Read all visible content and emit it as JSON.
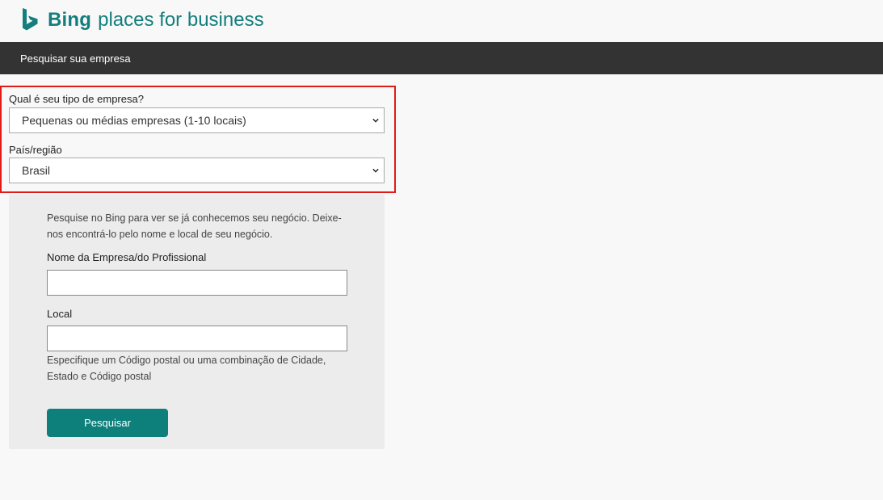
{
  "brand": {
    "name_bold": "Bing",
    "name_rest": "places for business",
    "color": "#137e7d"
  },
  "navbar": {
    "title": "Pesquisar sua empresa"
  },
  "business_type": {
    "label": "Qual é seu tipo de empresa?",
    "selected": "Pequenas ou médias empresas (1-10 locais)"
  },
  "country": {
    "label": "País/região",
    "selected": "Brasil"
  },
  "search_panel": {
    "intro_line1": "Pesquise no Bing para ver se já conhecemos seu negócio. Deixe-",
    "intro_line2": "nos encontrá-lo pelo nome e local de seu negócio.",
    "business_name_label": "Nome da Empresa/do Profissional",
    "business_name_value": "",
    "location_label": "Local",
    "location_value": "",
    "location_hint_line1": "Especifique um Código postal ou uma combinação de Cidade,",
    "location_hint_line2": "Estado e Código postal",
    "search_button": "Pesquisar"
  },
  "colors": {
    "accent": "#0e807c",
    "navbar_bg": "#333333",
    "highlight": "#e11a1a"
  }
}
